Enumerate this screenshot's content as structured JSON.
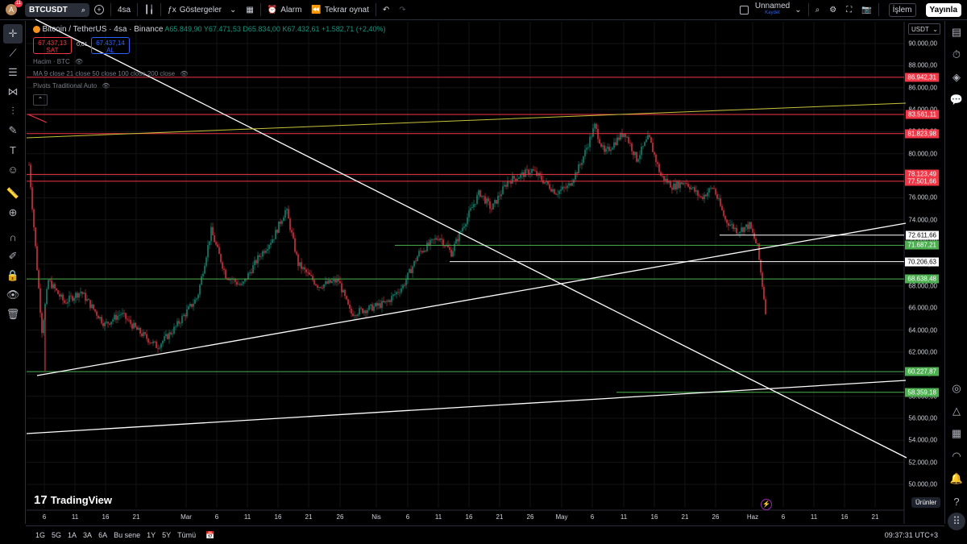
{
  "topbar": {
    "avatar_letter": "A",
    "notification_count": "11",
    "symbol": "BTCUSDT",
    "interval": "4sa",
    "indicators_label": "Göstergeler",
    "alarm_label": "Alarm",
    "replay_label": "Tekrar oynat",
    "layout_name": "Unnamed",
    "layout_status": "Kaydet",
    "trade_label": "İşlem",
    "publish_label": "Yayınla"
  },
  "legend": {
    "title": "Bitcoin / TetherUS · 4sa · Binance",
    "open": "A65.849,90",
    "high": "Y67.471,53",
    "low": "D65.834,00",
    "close": "K67.432,61",
    "change": "+1.582,71 (+2,40%)",
    "sell_price": "67.437,13",
    "sell_label": "SAT",
    "spread": "0,01",
    "buy_price": "67.437,14",
    "buy_label": "AL",
    "volume_label": "Hacim · BTC",
    "ma_label": "MA 9 close 21 close 50 close 100 close 200 close",
    "pivots_label": "Pivots Traditional Auto"
  },
  "price_axis": {
    "currency": "USDT",
    "ticks": [
      "90.000,00",
      "88.000,00",
      "86.000,00",
      "84.000,00",
      "82.000,00",
      "80.000,00",
      "78.000,00",
      "76.000,00",
      "74.000,00",
      "72.000,00",
      "70.000,00",
      "68.000,00",
      "66.000,00",
      "64.000,00",
      "62.000,00",
      "60.000,00",
      "58.000,00",
      "56.000,00",
      "54.000,00",
      "52.000,00",
      "50.000,00"
    ],
    "tags": [
      {
        "price": "86.942,31",
        "color": "#f23645"
      },
      {
        "price": "83.561,11",
        "color": "#f23645"
      },
      {
        "price": "81.823,98",
        "color": "#f23645"
      },
      {
        "price": "78.123,49",
        "color": "#f23645"
      },
      {
        "price": "77.501,66",
        "color": "#f23645"
      },
      {
        "price": "72.611,66",
        "color": "#ffffff"
      },
      {
        "price": "71.687,21",
        "color": "#4caf50"
      },
      {
        "price": "70.206,63",
        "color": "#ffffff"
      },
      {
        "price": "68.638,48",
        "color": "#4caf50"
      },
      {
        "price": "60.227,87",
        "color": "#4caf50"
      },
      {
        "price": "58.359,18",
        "color": "#4caf50"
      }
    ]
  },
  "time_axis": {
    "labels": [
      "6",
      "11",
      "16",
      "21",
      "Mar",
      "6",
      "11",
      "16",
      "21",
      "26",
      "Nis",
      "6",
      "11",
      "16",
      "21",
      "26",
      "May",
      "6",
      "11",
      "16",
      "21",
      "26",
      "Haz",
      "6",
      "11",
      "16",
      "21"
    ]
  },
  "bottombar": {
    "ranges": [
      "1G",
      "5G",
      "1A",
      "3A",
      "6A",
      "Bu sene",
      "1Y",
      "5Y",
      "Tümü"
    ],
    "clock": "09:37:31 UTC+3"
  },
  "watermark": "TradingView",
  "products_label": "Ürünler",
  "colors": {
    "up": "#089981",
    "down": "#f23645",
    "support": "#4caf50",
    "resistance": "#f23645",
    "trend": "#ffffff"
  }
}
